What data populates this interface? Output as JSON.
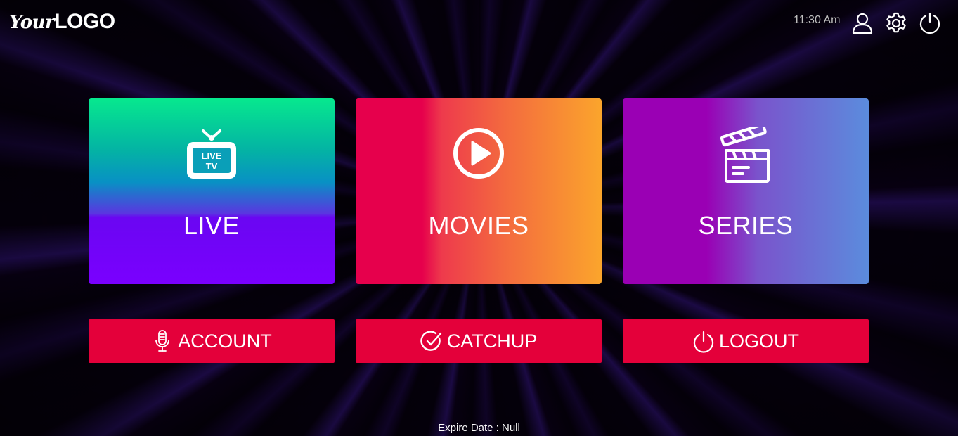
{
  "header": {
    "logo": {
      "prefix": "Your",
      "main": "LOGO"
    },
    "time": "11:30 Am",
    "icons": [
      "user-icon",
      "gear-icon",
      "power-icon"
    ]
  },
  "tiles": [
    {
      "label": "LIVE",
      "icon": "live-tv-icon",
      "icon_text_line1": "LIVE",
      "icon_text_line2": "TV"
    },
    {
      "label": "MOVIES",
      "icon": "play-circle-icon"
    },
    {
      "label": "SERIES",
      "icon": "clapperboard-icon"
    }
  ],
  "buttons": [
    {
      "label": "ACCOUNT",
      "icon": "microphone-icon"
    },
    {
      "label": "CATCHUP",
      "icon": "check-circle-icon"
    },
    {
      "label": "LOGOUT",
      "icon": "power-icon"
    }
  ],
  "footer": {
    "expire_text": "Expire Date : Null"
  },
  "colors": {
    "button_red": "#e4003a",
    "live_gradient": [
      "#06e88e",
      "#7a00ff"
    ],
    "movies_gradient": [
      "#e6004c",
      "#fba52c"
    ],
    "series_gradient": [
      "#9a00b4",
      "#5b8cdd"
    ]
  }
}
